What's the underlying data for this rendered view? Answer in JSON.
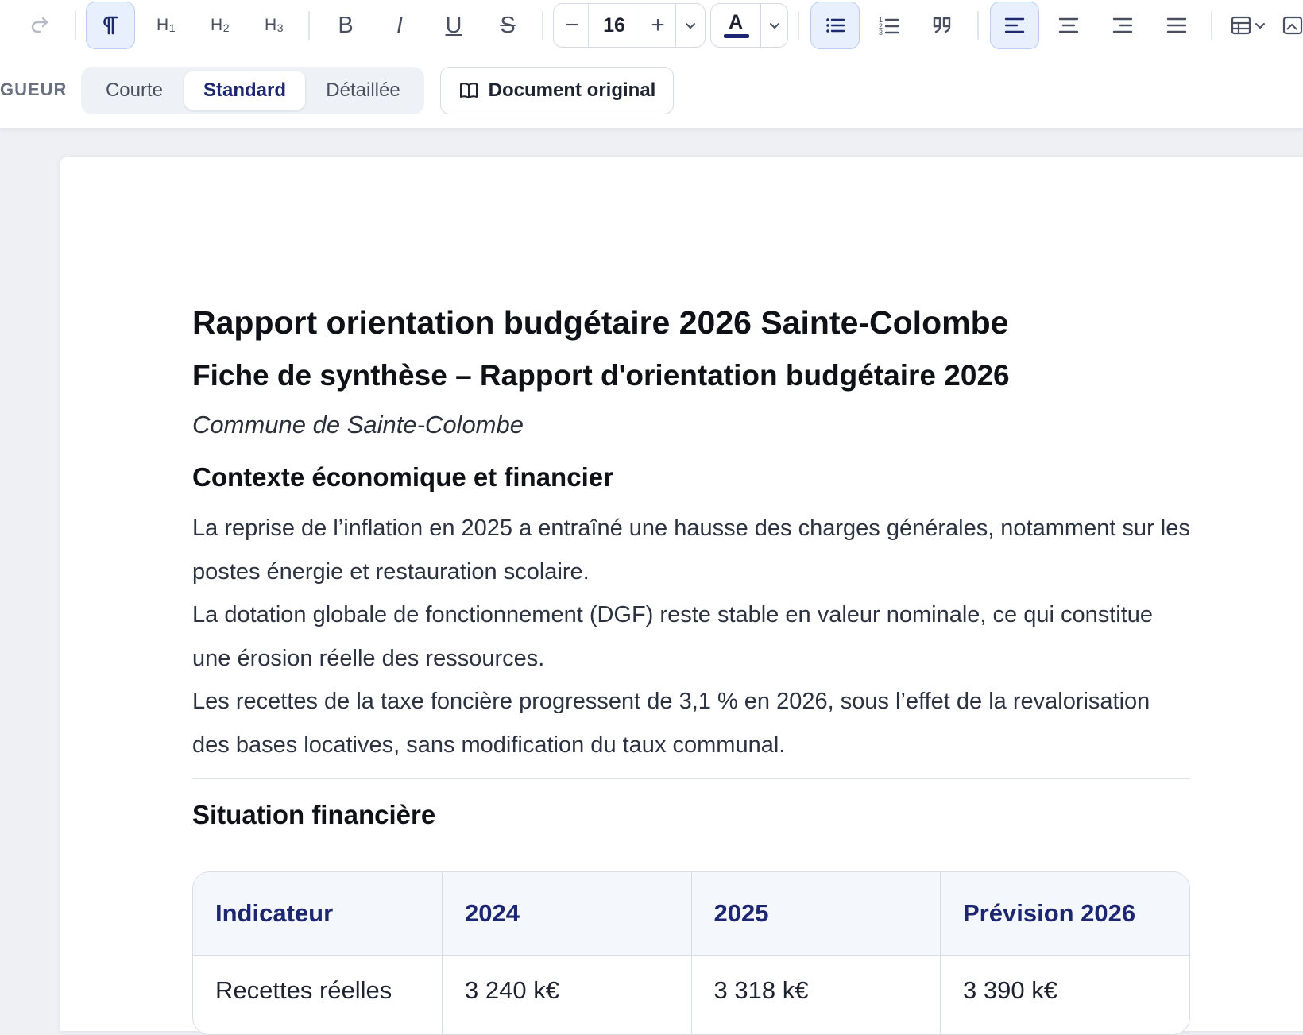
{
  "toolbar": {
    "font_size": "16",
    "color_letter": "A",
    "headings": [
      {
        "main": "H",
        "sub": "1"
      },
      {
        "main": "H",
        "sub": "2"
      },
      {
        "main": "H",
        "sub": "3"
      }
    ],
    "format": {
      "bold": "B",
      "italic": "I",
      "underline": "U",
      "strike": "S"
    },
    "minus": "−",
    "plus": "+",
    "active_color": "#1d2670"
  },
  "length": {
    "label": "GUEUR",
    "options": [
      "Courte",
      "Standard",
      "Détaillée"
    ],
    "selected": "Standard"
  },
  "original_button": {
    "label": "Document original"
  },
  "document": {
    "title": "Rapport orientation budgétaire 2026 Sainte-Colombe",
    "subtitle": "Fiche de synthèse – Rapport d'orientation budgétaire 2026",
    "commune": "Commune de Sainte-Colombe",
    "section1_title": "Contexte économique et financier",
    "section1_paragraphs": [
      "La reprise de l’inflation en 2025 a entraîné une hausse des charges générales, notamment sur les postes énergie et restauration scolaire.",
      "La dotation globale de fonctionnement (DGF) reste stable en valeur nominale, ce qui constitue une érosion réelle des ressources.",
      "Les recettes de la taxe foncière progressent de 3,1 % en 2026, sous l’effet de la revalorisation des bases locatives, sans modification du taux communal."
    ],
    "section2_title": "Situation financière",
    "table": {
      "headers": [
        "Indicateur",
        "2024",
        "2025",
        "Prévision 2026"
      ],
      "rows": [
        [
          "Recettes réelles",
          "3 240 k€",
          "3 318 k€",
          "3 390 k€"
        ]
      ]
    }
  }
}
